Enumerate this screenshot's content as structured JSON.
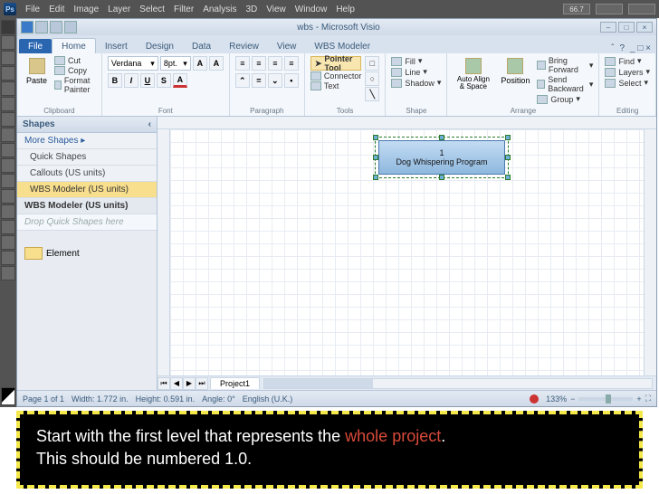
{
  "ps_menu": {
    "items": [
      "File",
      "Edit",
      "Image",
      "Layer",
      "Select",
      "Filter",
      "Analysis",
      "3D",
      "View",
      "Window",
      "Help"
    ],
    "zoom": "66.7"
  },
  "window": {
    "title": "wbs - Microsoft Visio"
  },
  "tabs": {
    "file": "File",
    "items": [
      "Home",
      "Insert",
      "Design",
      "Data",
      "Review",
      "View",
      "WBS Modeler"
    ],
    "active": 0
  },
  "ribbon": {
    "clipboard": {
      "paste": "Paste",
      "cut": "Cut",
      "copy": "Copy",
      "format_painter": "Format Painter",
      "label": "Clipboard"
    },
    "font": {
      "family": "Verdana",
      "size": "8pt.",
      "label": "Font"
    },
    "paragraph": {
      "label": "Paragraph"
    },
    "tools": {
      "pointer": "Pointer Tool",
      "connector": "Connector",
      "text": "Text",
      "label": "Tools"
    },
    "shape": {
      "fill": "Fill",
      "line": "Line",
      "shadow": "Shadow",
      "label": "Shape"
    },
    "arrange": {
      "auto_align": "Auto Align & Space",
      "position": "Position",
      "bring_forward": "Bring Forward",
      "send_backward": "Send Backward",
      "group": "Group",
      "label": "Arrange"
    },
    "editing": {
      "find": "Find",
      "layers": "Layers",
      "select": "Select",
      "label": "Editing"
    }
  },
  "shapes_panel": {
    "title": "Shapes",
    "more": "More Shapes",
    "quick": "Quick Shapes",
    "callouts": "Callouts (US units)",
    "wbs": "WBS Modeler (US units)",
    "wbs2": "WBS Modeler (US units)",
    "drop": "Drop Quick Shapes here",
    "element": "Element"
  },
  "sheet": {
    "page": "Project1"
  },
  "wbs_box": {
    "number": "1",
    "title": "Dog Whispering Program"
  },
  "status": {
    "page": "Page 1 of 1",
    "width": "Width: 1.772 in.",
    "height": "Height: 0.591 in.",
    "angle": "Angle: 0°",
    "lang": "English (U.K.)",
    "zoom": "133%"
  },
  "caption": {
    "line1a": "Start with the first level that represents the ",
    "highlight": "whole project",
    "line1b": ".",
    "line2": "This should be numbered 1.0."
  }
}
